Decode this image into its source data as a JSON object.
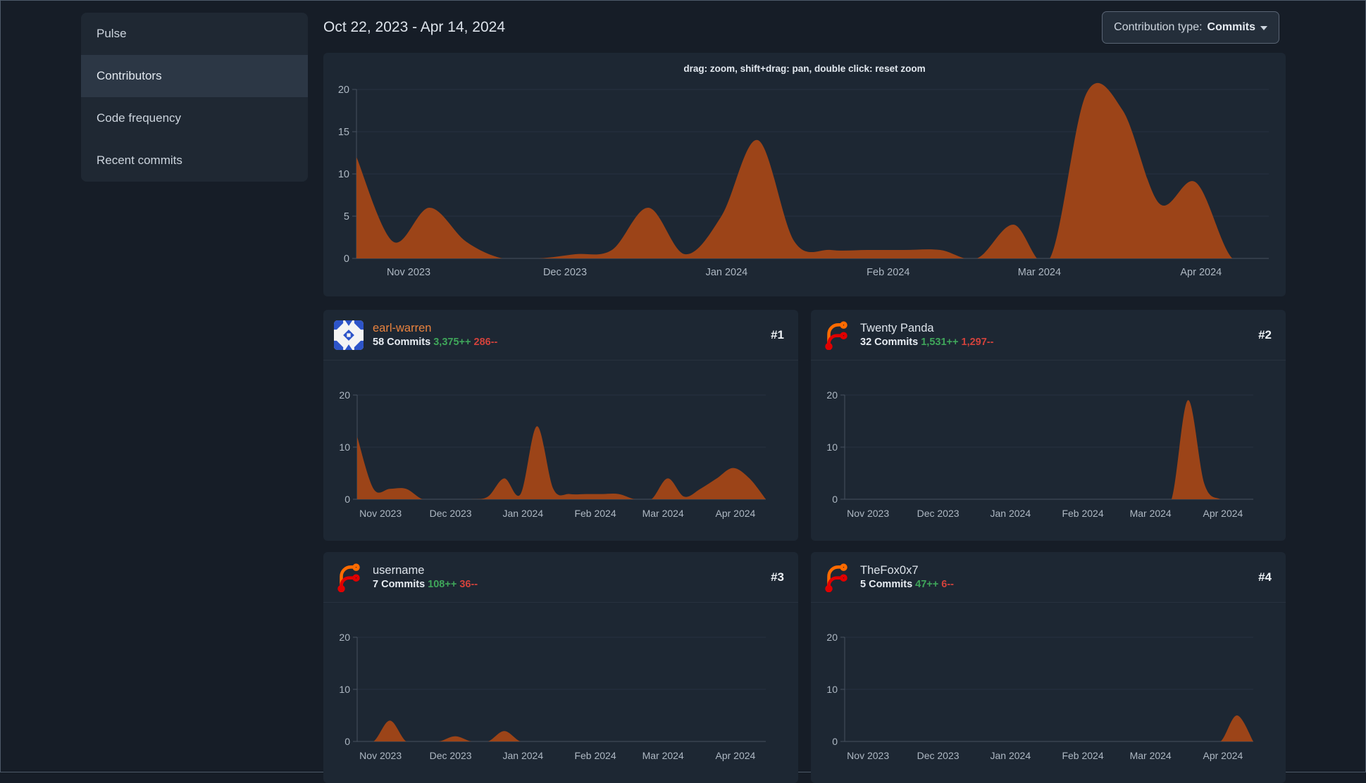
{
  "theme": {
    "page-bg": "#161d27",
    "panel-bg": "#1d2733",
    "chart-orange": "#9c4418",
    "green": "#3fa65a",
    "red": "#d2423c",
    "link-orange": "#e8823e"
  },
  "sidebar": {
    "items": [
      {
        "label": "Pulse",
        "active": false
      },
      {
        "label": "Contributors",
        "active": true
      },
      {
        "label": "Code frequency",
        "active": false
      },
      {
        "label": "Recent commits",
        "active": false
      }
    ]
  },
  "header": {
    "date_range": "Oct 22, 2023 - Apr 14, 2024",
    "contribution_type_label": "Contribution type:",
    "contribution_type_value": "Commits"
  },
  "main_panel": {
    "zoom_hint": "drag: zoom, shift+drag: pan, double click: reset zoom"
  },
  "cards": [
    {
      "rank": "#1",
      "name": "earl-warren",
      "is_link": true,
      "avatar": "identicon-blue",
      "commits": "58 Commits",
      "additions": "3,375++",
      "deletions": "286--",
      "chart": "earl-warren"
    },
    {
      "rank": "#2",
      "name": "Twenty Panda",
      "is_link": false,
      "avatar": "forgejo-logo",
      "commits": "32 Commits",
      "additions": "1,531++",
      "deletions": "1,297--",
      "chart": "twenty-panda"
    },
    {
      "rank": "#3",
      "name": "username",
      "is_link": false,
      "avatar": "forgejo-logo",
      "commits": "7 Commits",
      "additions": "108++",
      "deletions": "36--",
      "chart": "username"
    },
    {
      "rank": "#4",
      "name": "TheFox0x7",
      "is_link": false,
      "avatar": "forgejo-logo",
      "commits": "5 Commits",
      "additions": "47++",
      "deletions": "6--",
      "chart": "thefox0x7"
    }
  ],
  "chart_data": [
    {
      "id": "overall",
      "type": "area",
      "role": "main",
      "x_start": "Oct 22, 2023",
      "x_end": "Apr 14, 2024",
      "x_unit": "week",
      "x_tick_labels": [
        "Nov 2023",
        "Dec 2023",
        "Jan 2024",
        "Feb 2024",
        "Mar 2024",
        "Apr 2024"
      ],
      "weekly_values": [
        12,
        2,
        6,
        2,
        0,
        0,
        0.5,
        1,
        6,
        0.5,
        5,
        14,
        2,
        1,
        1,
        1,
        1,
        0,
        4,
        0,
        19.5,
        17.5,
        6.5,
        9,
        0,
        0
      ],
      "ylim": [
        0,
        20
      ],
      "y_ticks": [
        0,
        5,
        10,
        15,
        20
      ],
      "grid": true,
      "color": "#9c4418"
    },
    {
      "id": "earl-warren",
      "type": "area",
      "role": "mini",
      "x_start": "Oct 22, 2023",
      "x_end": "Apr 14, 2024",
      "x_unit": "week",
      "x_tick_labels": [
        "Nov 2023",
        "Dec 2023",
        "Jan 2024",
        "Feb 2024",
        "Mar 2024",
        "Apr 2024"
      ],
      "weekly_values": [
        12,
        2,
        2,
        2,
        0,
        0,
        0,
        0,
        0.5,
        4,
        1,
        14,
        2,
        1,
        1,
        1,
        1,
        0,
        0,
        4,
        0.5,
        2,
        4,
        6,
        4,
        0
      ],
      "ylim": [
        0,
        20
      ],
      "y_ticks": [
        0,
        10,
        20
      ],
      "grid": true,
      "color": "#9c4418"
    },
    {
      "id": "twenty-panda",
      "type": "area",
      "role": "mini",
      "x_start": "Oct 22, 2023",
      "x_end": "Apr 14, 2024",
      "x_unit": "week",
      "x_tick_labels": [
        "Nov 2023",
        "Dec 2023",
        "Jan 2024",
        "Feb 2024",
        "Mar 2024",
        "Apr 2024"
      ],
      "weekly_values": [
        0,
        0,
        0,
        0,
        0,
        0,
        0,
        0,
        0,
        0,
        0,
        0,
        0,
        0,
        0,
        0,
        0,
        0,
        0,
        0,
        0,
        19,
        3,
        0,
        0,
        0
      ],
      "ylim": [
        0,
        20
      ],
      "y_ticks": [
        0,
        10,
        20
      ],
      "grid": true,
      "color": "#9c4418"
    },
    {
      "id": "username",
      "type": "area",
      "role": "mini",
      "x_start": "Oct 22, 2023",
      "x_end": "Apr 14, 2024",
      "x_unit": "week",
      "x_tick_labels": [
        "Nov 2023",
        "Dec 2023",
        "Jan 2024",
        "Feb 2024",
        "Mar 2024",
        "Apr 2024"
      ],
      "weekly_values": [
        0,
        0,
        4,
        0,
        0,
        0,
        1,
        0,
        0,
        2,
        0,
        0,
        0,
        0,
        0,
        0,
        0,
        0,
        0,
        0,
        0,
        0,
        0,
        0,
        0,
        0
      ],
      "ylim": [
        0,
        20
      ],
      "y_ticks": [
        0,
        10,
        20
      ],
      "grid": true,
      "color": "#9c4418"
    },
    {
      "id": "thefox0x7",
      "type": "area",
      "role": "mini",
      "x_start": "Oct 22, 2023",
      "x_end": "Apr 14, 2024",
      "x_unit": "week",
      "x_tick_labels": [
        "Nov 2023",
        "Dec 2023",
        "Jan 2024",
        "Feb 2024",
        "Mar 2024",
        "Apr 2024"
      ],
      "weekly_values": [
        0,
        0,
        0,
        0,
        0,
        0,
        0,
        0,
        0,
        0,
        0,
        0,
        0,
        0,
        0,
        0,
        0,
        0,
        0,
        0,
        0,
        0,
        0,
        0,
        5,
        0
      ],
      "ylim": [
        0,
        20
      ],
      "y_ticks": [
        0,
        10,
        20
      ],
      "grid": true,
      "color": "#9c4418"
    }
  ]
}
